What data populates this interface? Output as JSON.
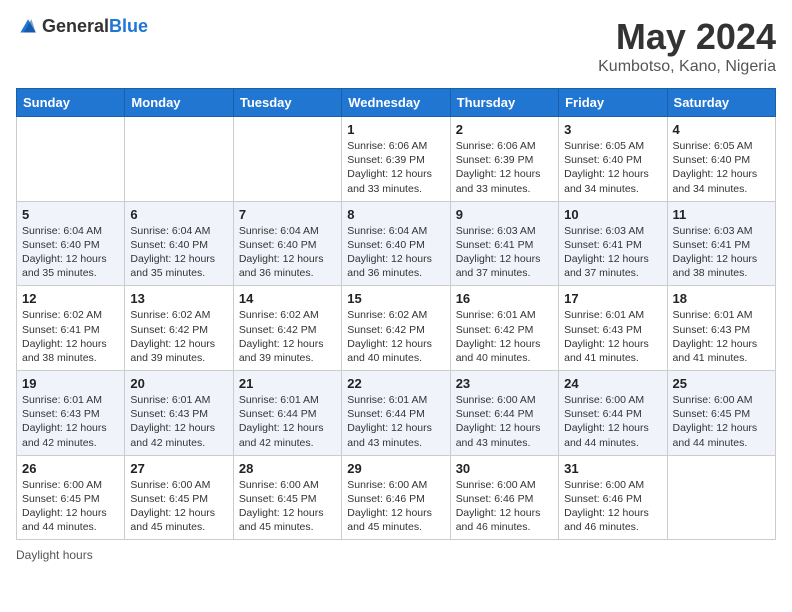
{
  "header": {
    "logo_general": "General",
    "logo_blue": "Blue",
    "title": "May 2024",
    "subtitle": "Kumbotso, Kano, Nigeria"
  },
  "columns": [
    "Sunday",
    "Monday",
    "Tuesday",
    "Wednesday",
    "Thursday",
    "Friday",
    "Saturday"
  ],
  "weeks": [
    [
      {
        "day": "",
        "sunrise": "",
        "sunset": "",
        "daylight": ""
      },
      {
        "day": "",
        "sunrise": "",
        "sunset": "",
        "daylight": ""
      },
      {
        "day": "",
        "sunrise": "",
        "sunset": "",
        "daylight": ""
      },
      {
        "day": "1",
        "sunrise": "Sunrise: 6:06 AM",
        "sunset": "Sunset: 6:39 PM",
        "daylight": "Daylight: 12 hours and 33 minutes."
      },
      {
        "day": "2",
        "sunrise": "Sunrise: 6:06 AM",
        "sunset": "Sunset: 6:39 PM",
        "daylight": "Daylight: 12 hours and 33 minutes."
      },
      {
        "day": "3",
        "sunrise": "Sunrise: 6:05 AM",
        "sunset": "Sunset: 6:40 PM",
        "daylight": "Daylight: 12 hours and 34 minutes."
      },
      {
        "day": "4",
        "sunrise": "Sunrise: 6:05 AM",
        "sunset": "Sunset: 6:40 PM",
        "daylight": "Daylight: 12 hours and 34 minutes."
      }
    ],
    [
      {
        "day": "5",
        "sunrise": "Sunrise: 6:04 AM",
        "sunset": "Sunset: 6:40 PM",
        "daylight": "Daylight: 12 hours and 35 minutes."
      },
      {
        "day": "6",
        "sunrise": "Sunrise: 6:04 AM",
        "sunset": "Sunset: 6:40 PM",
        "daylight": "Daylight: 12 hours and 35 minutes."
      },
      {
        "day": "7",
        "sunrise": "Sunrise: 6:04 AM",
        "sunset": "Sunset: 6:40 PM",
        "daylight": "Daylight: 12 hours and 36 minutes."
      },
      {
        "day": "8",
        "sunrise": "Sunrise: 6:04 AM",
        "sunset": "Sunset: 6:40 PM",
        "daylight": "Daylight: 12 hours and 36 minutes."
      },
      {
        "day": "9",
        "sunrise": "Sunrise: 6:03 AM",
        "sunset": "Sunset: 6:41 PM",
        "daylight": "Daylight: 12 hours and 37 minutes."
      },
      {
        "day": "10",
        "sunrise": "Sunrise: 6:03 AM",
        "sunset": "Sunset: 6:41 PM",
        "daylight": "Daylight: 12 hours and 37 minutes."
      },
      {
        "day": "11",
        "sunrise": "Sunrise: 6:03 AM",
        "sunset": "Sunset: 6:41 PM",
        "daylight": "Daylight: 12 hours and 38 minutes."
      }
    ],
    [
      {
        "day": "12",
        "sunrise": "Sunrise: 6:02 AM",
        "sunset": "Sunset: 6:41 PM",
        "daylight": "Daylight: 12 hours and 38 minutes."
      },
      {
        "day": "13",
        "sunrise": "Sunrise: 6:02 AM",
        "sunset": "Sunset: 6:42 PM",
        "daylight": "Daylight: 12 hours and 39 minutes."
      },
      {
        "day": "14",
        "sunrise": "Sunrise: 6:02 AM",
        "sunset": "Sunset: 6:42 PM",
        "daylight": "Daylight: 12 hours and 39 minutes."
      },
      {
        "day": "15",
        "sunrise": "Sunrise: 6:02 AM",
        "sunset": "Sunset: 6:42 PM",
        "daylight": "Daylight: 12 hours and 40 minutes."
      },
      {
        "day": "16",
        "sunrise": "Sunrise: 6:01 AM",
        "sunset": "Sunset: 6:42 PM",
        "daylight": "Daylight: 12 hours and 40 minutes."
      },
      {
        "day": "17",
        "sunrise": "Sunrise: 6:01 AM",
        "sunset": "Sunset: 6:43 PM",
        "daylight": "Daylight: 12 hours and 41 minutes."
      },
      {
        "day": "18",
        "sunrise": "Sunrise: 6:01 AM",
        "sunset": "Sunset: 6:43 PM",
        "daylight": "Daylight: 12 hours and 41 minutes."
      }
    ],
    [
      {
        "day": "19",
        "sunrise": "Sunrise: 6:01 AM",
        "sunset": "Sunset: 6:43 PM",
        "daylight": "Daylight: 12 hours and 42 minutes."
      },
      {
        "day": "20",
        "sunrise": "Sunrise: 6:01 AM",
        "sunset": "Sunset: 6:43 PM",
        "daylight": "Daylight: 12 hours and 42 minutes."
      },
      {
        "day": "21",
        "sunrise": "Sunrise: 6:01 AM",
        "sunset": "Sunset: 6:44 PM",
        "daylight": "Daylight: 12 hours and 42 minutes."
      },
      {
        "day": "22",
        "sunrise": "Sunrise: 6:01 AM",
        "sunset": "Sunset: 6:44 PM",
        "daylight": "Daylight: 12 hours and 43 minutes."
      },
      {
        "day": "23",
        "sunrise": "Sunrise: 6:00 AM",
        "sunset": "Sunset: 6:44 PM",
        "daylight": "Daylight: 12 hours and 43 minutes."
      },
      {
        "day": "24",
        "sunrise": "Sunrise: 6:00 AM",
        "sunset": "Sunset: 6:44 PM",
        "daylight": "Daylight: 12 hours and 44 minutes."
      },
      {
        "day": "25",
        "sunrise": "Sunrise: 6:00 AM",
        "sunset": "Sunset: 6:45 PM",
        "daylight": "Daylight: 12 hours and 44 minutes."
      }
    ],
    [
      {
        "day": "26",
        "sunrise": "Sunrise: 6:00 AM",
        "sunset": "Sunset: 6:45 PM",
        "daylight": "Daylight: 12 hours and 44 minutes."
      },
      {
        "day": "27",
        "sunrise": "Sunrise: 6:00 AM",
        "sunset": "Sunset: 6:45 PM",
        "daylight": "Daylight: 12 hours and 45 minutes."
      },
      {
        "day": "28",
        "sunrise": "Sunrise: 6:00 AM",
        "sunset": "Sunset: 6:45 PM",
        "daylight": "Daylight: 12 hours and 45 minutes."
      },
      {
        "day": "29",
        "sunrise": "Sunrise: 6:00 AM",
        "sunset": "Sunset: 6:46 PM",
        "daylight": "Daylight: 12 hours and 45 minutes."
      },
      {
        "day": "30",
        "sunrise": "Sunrise: 6:00 AM",
        "sunset": "Sunset: 6:46 PM",
        "daylight": "Daylight: 12 hours and 46 minutes."
      },
      {
        "day": "31",
        "sunrise": "Sunrise: 6:00 AM",
        "sunset": "Sunset: 6:46 PM",
        "daylight": "Daylight: 12 hours and 46 minutes."
      },
      {
        "day": "",
        "sunrise": "",
        "sunset": "",
        "daylight": ""
      }
    ]
  ],
  "footer": {
    "note": "Daylight hours"
  }
}
